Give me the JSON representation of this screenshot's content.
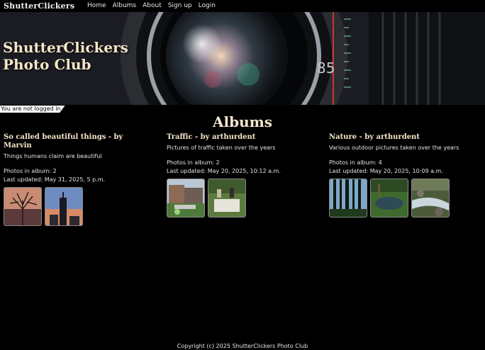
{
  "nav": {
    "brand": "ShutterClickers",
    "links": [
      "Home",
      "Albums",
      "About",
      "Sign up",
      "Login"
    ]
  },
  "hero": {
    "title_line1": "ShutterClickers",
    "title_line2": "Photo Club"
  },
  "login_status": "You are not logged in",
  "page_title": "Albums",
  "albums": [
    {
      "title": "So called beautiful things - by Marvin",
      "description": "Things humans claim are beautiful",
      "photos_count": "Photos in album: 2",
      "last_updated": "Last updated: May 31, 2025, 5 p.m."
    },
    {
      "title": "Traffic - by arthurdent",
      "description": "Pictures of traffic taken over the years",
      "photos_count": "Photos in album: 2",
      "last_updated": "Last updated: May 20, 2025, 10:12 a.m."
    },
    {
      "title": "Nature - by arthurdent",
      "description": "Various outdoor pictures taken over the years",
      "photos_count": "Photos in album: 4",
      "last_updated": "Last updated: May 20, 2025, 10:09 a.m."
    }
  ],
  "footer": "Copyright (c) 2025 ShutterClickers Photo Club"
}
